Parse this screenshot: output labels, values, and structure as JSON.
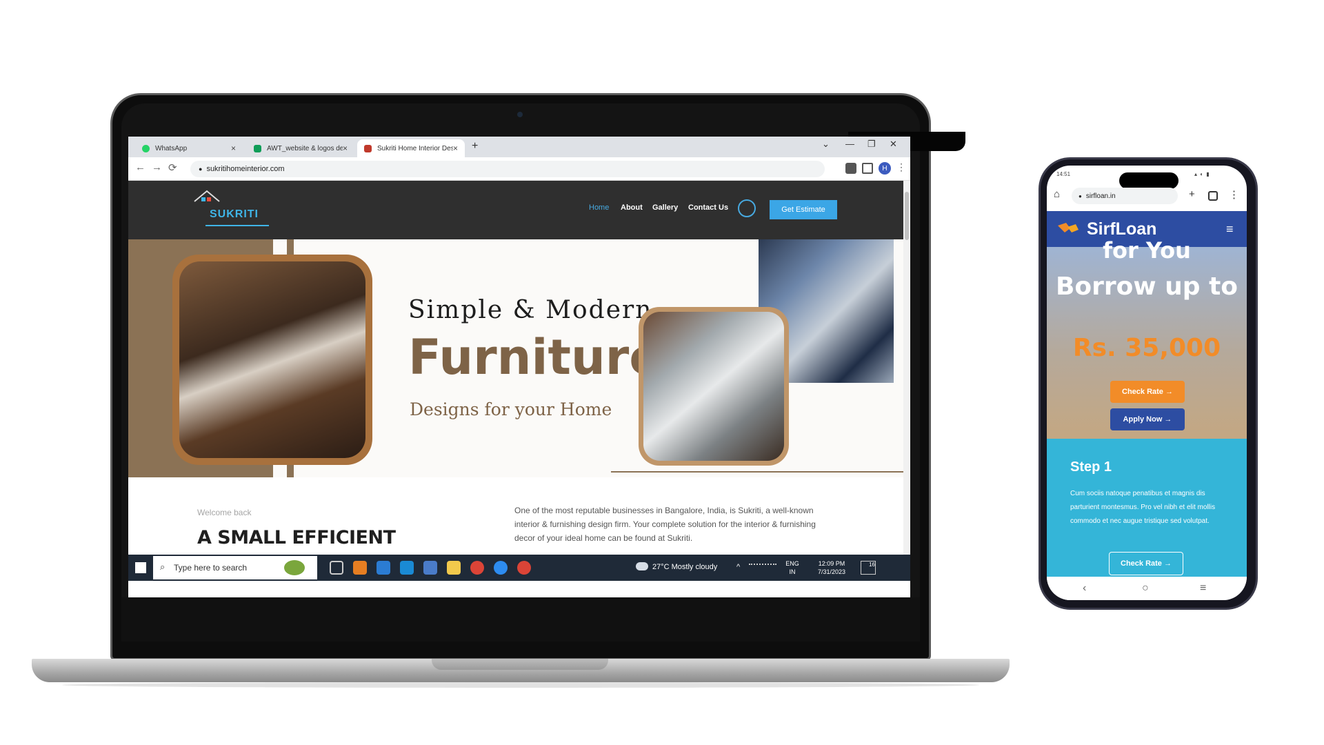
{
  "laptop": {
    "browser": {
      "tabs": [
        {
          "label": "WhatsApp",
          "color": "#25d366"
        },
        {
          "label": "AWT_website & logos details - G",
          "color": "#0f9d58"
        },
        {
          "label": "Sukriti Home Interior Design – B",
          "color": "#c0392b"
        }
      ],
      "new_tab": "+",
      "url": "sukritihomeinterior.com",
      "nav": {
        "back": "←",
        "forward": "→",
        "reload": "⟳",
        "lock": "🔒"
      },
      "window": {
        "minimize": "—",
        "restore": "❐",
        "close": "✕",
        "tabs_menu": "⌄"
      },
      "profile": "H"
    },
    "site": {
      "logo_text": "SUKRITI",
      "nav": [
        "Home",
        "About",
        "Gallery",
        "Contact Us"
      ],
      "cta": "Get Estimate",
      "hero": {
        "line1": "Simple & Modern",
        "line2": "Furniture",
        "line3": "Designs for your Home"
      },
      "welcome": "Welcome back",
      "heading": "A SMALL EFFICIENT",
      "paragraph": "One of the most reputable businesses in Bangalore, India, is Sukriti, a well-known interior & furnishing design firm. Your complete solution for the interior & furnishing decor of your ideal home can be found at Sukriti."
    },
    "taskbar": {
      "search_placeholder": "Type here to search",
      "weather": "27°C  Mostly cloudy",
      "lang": "ENG",
      "region": "IN",
      "time": "12:09 PM",
      "date": "7/31/2023",
      "notifications": "16"
    }
  },
  "phone": {
    "status_time": "14:51",
    "url": "sirfloan.in",
    "brand": "SirfLoan",
    "hero": {
      "cut_line": "for You",
      "headline": "Borrow up to",
      "amount": "Rs. 35,000",
      "check_rate": "Check Rate →",
      "apply_now": "Apply Now →"
    },
    "step": {
      "title": "Step 1",
      "text": "Cum sociis natoque penatibus et magnis dis parturient montesmus. Pro vel nibh et elit mollis commodo et nec augue tristique sed volutpat.",
      "button": "Check Rate →"
    },
    "colors": {
      "header": "#2d4da2",
      "accent": "#f28c28",
      "step_bg": "#34b5d8"
    }
  }
}
